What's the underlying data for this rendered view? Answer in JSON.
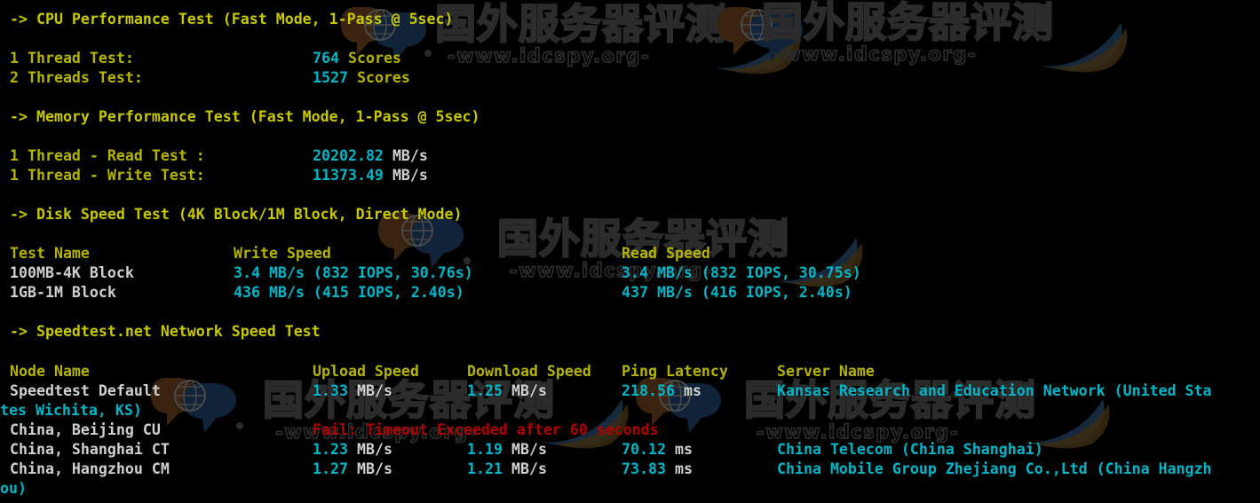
{
  "terminal": {
    "colors": {
      "background": "#000000",
      "heading": "#c8c800",
      "header": "#b4b400",
      "value": "#00b6c8",
      "plain": "#cfd0d0",
      "error": "#b00000",
      "watermark": "#2b2b2b"
    }
  },
  "watermark": {
    "text_cn": "国外服务器评测",
    "text_url": "-www.idcspy.org-",
    "logo_name": "speech-bubble-globe-logo"
  },
  "sections": {
    "cpu": {
      "heading": "-> CPU Performance Test (Fast Mode, 1-Pass @ 5sec)",
      "rows": [
        {
          "label": "1 Thread Test:",
          "value": "764",
          "unit": "Scores"
        },
        {
          "label": "2 Threads Test:",
          "value": "1527",
          "unit": "Scores"
        }
      ]
    },
    "memory": {
      "heading": "-> Memory Performance Test (Fast Mode, 1-Pass @ 5sec)",
      "rows": [
        {
          "label": "1 Thread - Read Test :",
          "value": "20202.82",
          "unit": "MB/s"
        },
        {
          "label": "1 Thread - Write Test:",
          "value": "11373.49",
          "unit": "MB/s"
        }
      ]
    },
    "disk": {
      "heading": "-> Disk Speed Test (4K Block/1M Block, Direct Mode)",
      "headers": {
        "test_name": "Test Name",
        "write_speed": "Write Speed",
        "read_speed": "Read Speed"
      },
      "rows": [
        {
          "name": "100MB-4K Block",
          "write": "3.4 MB/s (832 IOPS, 30.76s)",
          "read": "3.4 MB/s (832 IOPS, 30.75s)"
        },
        {
          "name": "1GB-1M Block",
          "write": "436 MB/s (415 IOPS, 2.40s)",
          "read": "437 MB/s (416 IOPS, 2.40s)"
        }
      ]
    },
    "speedtest": {
      "heading": "-> Speedtest.net Network Speed Test",
      "headers": {
        "node_name": "Node Name",
        "upload_speed": "Upload Speed",
        "download_speed": "Download Speed",
        "ping_latency": "Ping Latency",
        "server_name": "Server Name"
      },
      "rows": [
        {
          "node": "Speedtest Default",
          "upload_value": "1.33",
          "upload_unit": "MB/s",
          "download_value": "1.25",
          "download_unit": "MB/s",
          "ping_value": "218.56",
          "ping_unit": "ms",
          "server": "Kansas Research and Education Network (United Sta",
          "server_wrap": "tes Wichita, KS)",
          "error": ""
        },
        {
          "node": "China, Beijing CU",
          "upload_value": "",
          "upload_unit": "",
          "download_value": "",
          "download_unit": "",
          "ping_value": "",
          "ping_unit": "",
          "server": "",
          "server_wrap": "",
          "error": "Fail: Timeout Exceeded after 60 seconds"
        },
        {
          "node": "China, Shanghai CT",
          "upload_value": "1.23",
          "upload_unit": "MB/s",
          "download_value": "1.19",
          "download_unit": "MB/s",
          "ping_value": "70.12",
          "ping_unit": "ms",
          "server": "China Telecom (China Shanghai)",
          "server_wrap": "",
          "error": ""
        },
        {
          "node": "China, Hangzhou CM",
          "upload_value": "1.27",
          "upload_unit": "MB/s",
          "download_value": "1.21",
          "download_unit": "MB/s",
          "ping_value": "73.83",
          "ping_unit": "ms",
          "server": "China Mobile Group Zhejiang Co.,Ltd (China Hangzh",
          "server_wrap": "ou)",
          "error": ""
        }
      ]
    }
  }
}
